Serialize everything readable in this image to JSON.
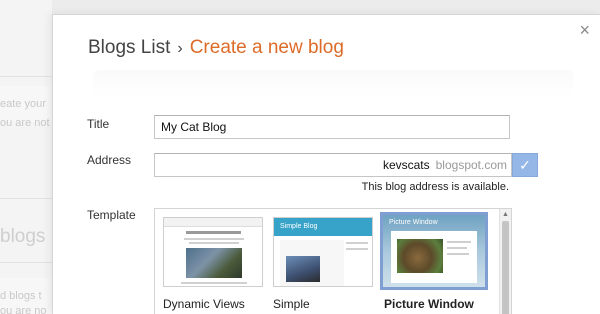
{
  "background": {
    "fragments": [
      "eate your",
      "ou are not a",
      "blogs",
      "d blogs t",
      "ou are no"
    ]
  },
  "dialog": {
    "close_glyph": "×",
    "breadcrumb": {
      "parent": "Blogs List",
      "separator": "›",
      "current": "Create a new blog"
    },
    "title_field": {
      "label": "Title",
      "value": "My Cat Blog"
    },
    "address_field": {
      "label": "Address",
      "value": "kevscats",
      "suffix": "blogspot.com",
      "check_glyph": "✓",
      "status": "This blog address is available."
    },
    "template_field": {
      "label": "Template",
      "thumb_texts": {
        "simple": "Simple Blog",
        "picture_window": "Picture Window"
      },
      "options": [
        {
          "name": "Dynamic Views",
          "selected": false
        },
        {
          "name": "Simple",
          "selected": false
        },
        {
          "name": "Picture Window",
          "selected": true
        }
      ]
    }
  },
  "colors": {
    "accent_orange": "#dd6b29",
    "check_button": "#94b7e8",
    "selected_border": "#7f9ed1"
  }
}
